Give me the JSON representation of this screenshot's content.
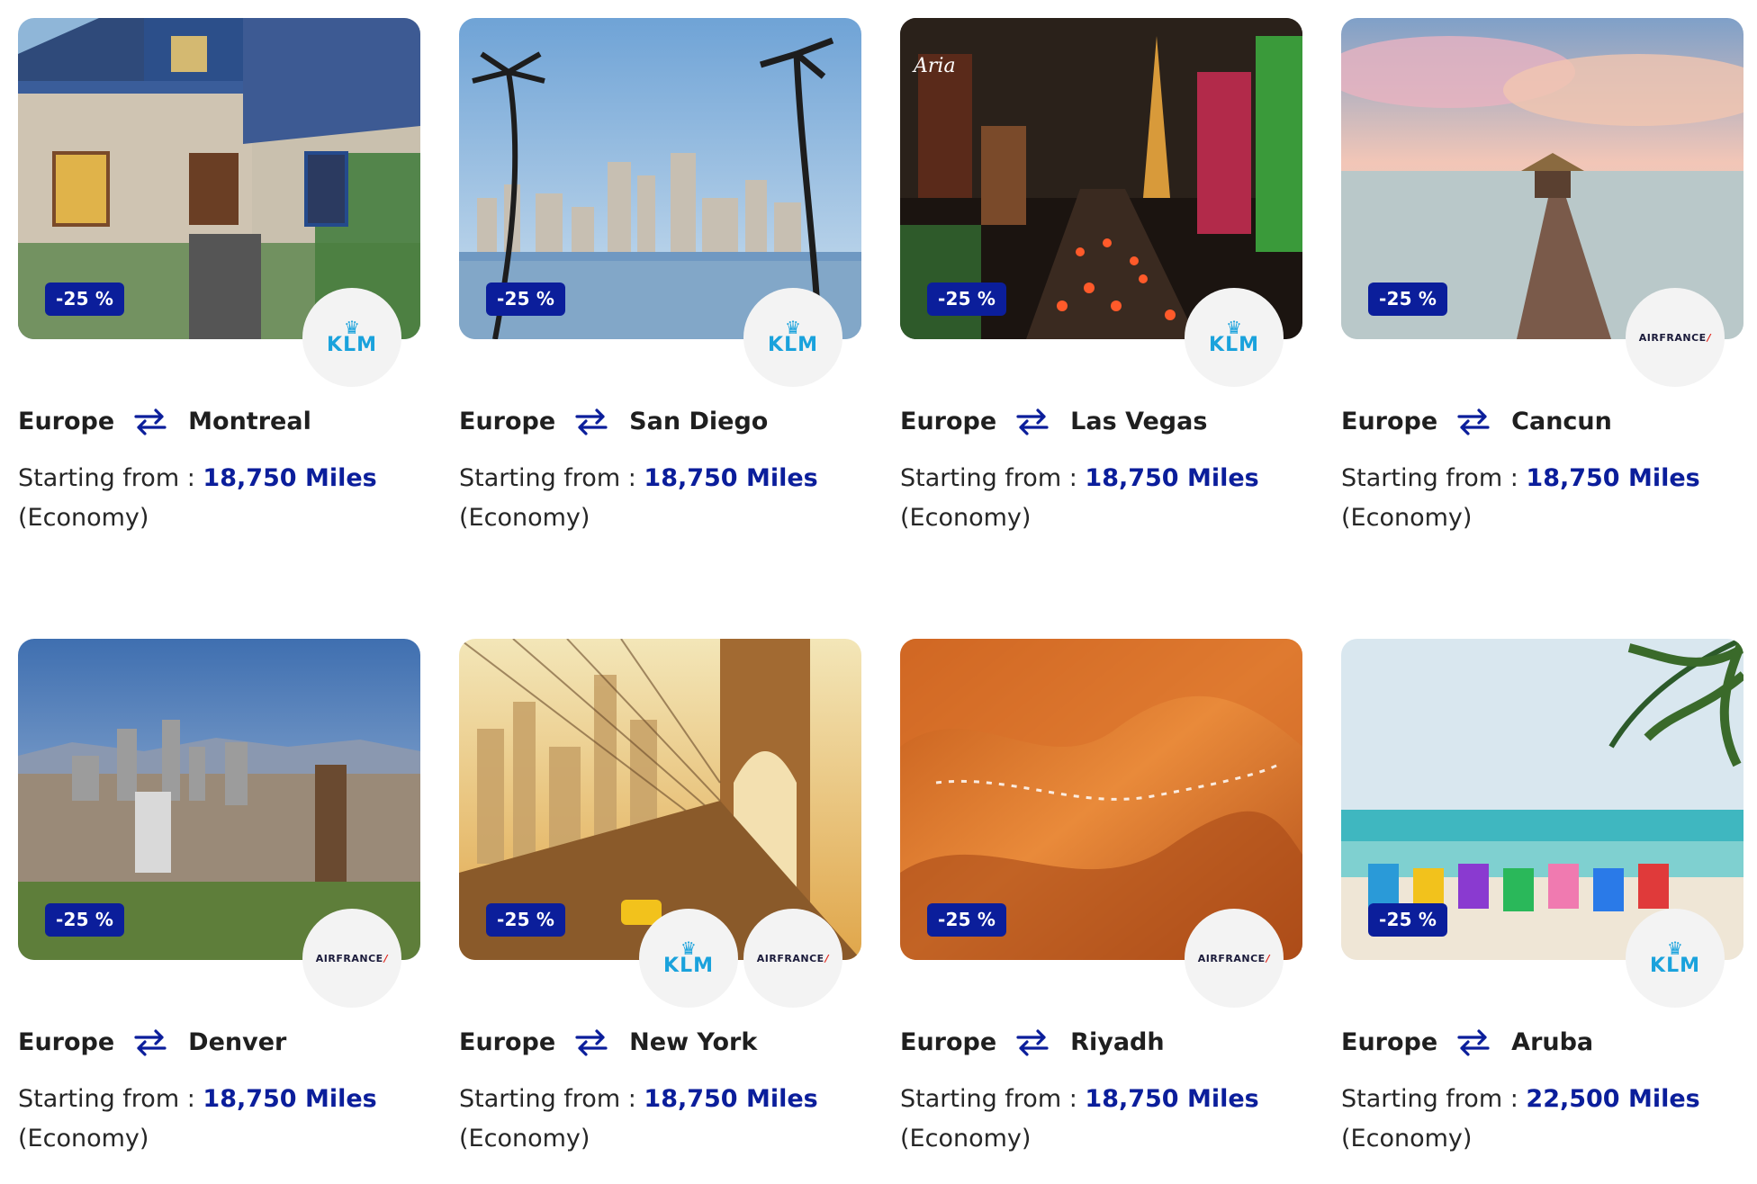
{
  "colors": {
    "accent": "#0b1e9b",
    "badge": "#0b1e9b",
    "klm": "#1aa2dc",
    "airfrance_slash": "#e1261c"
  },
  "icons": {
    "route": "swap-arrows-icon",
    "klm": "klm-crown-icon"
  },
  "cards": [
    {
      "scene": "montreal-houses",
      "discount": "-25 %",
      "airlines": [
        "KLM"
      ],
      "origin": "Europe",
      "destination": "Montreal",
      "price_label": "Starting from :",
      "miles": "18,750 Miles",
      "cabin": "(Economy)"
    },
    {
      "scene": "san-diego-skyline",
      "discount": "-25 %",
      "airlines": [
        "KLM"
      ],
      "origin": "Europe",
      "destination": "San Diego",
      "price_label": "Starting from :",
      "miles": "18,750 Miles",
      "cabin": "(Economy)"
    },
    {
      "scene": "las-vegas-strip",
      "discount": "-25 %",
      "airlines": [
        "KLM"
      ],
      "origin": "Europe",
      "destination": "Las Vegas",
      "price_label": "Starting from :",
      "miles": "18,750 Miles",
      "cabin": "(Economy)"
    },
    {
      "scene": "cancun-pier",
      "discount": "-25 %",
      "airlines": [
        "AIRFRANCE"
      ],
      "origin": "Europe",
      "destination": "Cancun",
      "price_label": "Starting from :",
      "miles": "18,750 Miles",
      "cabin": "(Economy)"
    },
    {
      "scene": "denver-skyline",
      "discount": "-25 %",
      "airlines": [
        "AIRFRANCE"
      ],
      "origin": "Europe",
      "destination": "Denver",
      "price_label": "Starting from :",
      "miles": "18,750 Miles",
      "cabin": "(Economy)"
    },
    {
      "scene": "new-york-bridge",
      "discount": "-25 %",
      "airlines": [
        "KLM",
        "AIRFRANCE"
      ],
      "origin": "Europe",
      "destination": "New York",
      "price_label": "Starting from :",
      "miles": "18,750 Miles",
      "cabin": "(Economy)"
    },
    {
      "scene": "riyadh-desert",
      "discount": "-25 %",
      "airlines": [
        "AIRFRANCE"
      ],
      "origin": "Europe",
      "destination": "Riyadh",
      "price_label": "Starting from :",
      "miles": "18,750 Miles",
      "cabin": "(Economy)"
    },
    {
      "scene": "aruba-beach",
      "discount": "-25 %",
      "airlines": [
        "KLM"
      ],
      "origin": "Europe",
      "destination": "Aruba",
      "price_label": "Starting from :",
      "miles": "22,500 Miles",
      "cabin": "(Economy)"
    }
  ]
}
